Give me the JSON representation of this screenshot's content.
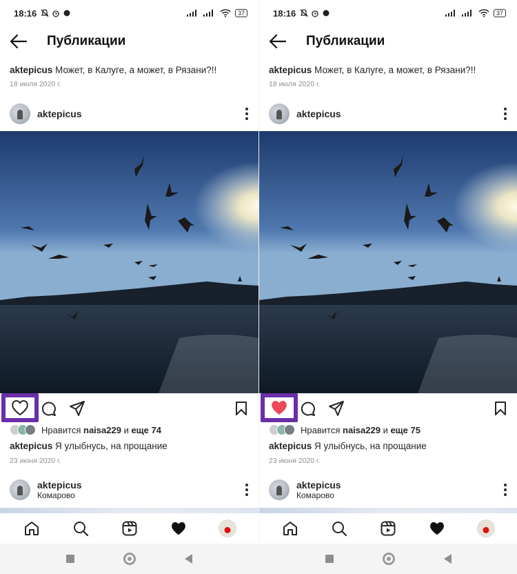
{
  "status_bar": {
    "time": "18:16",
    "battery": "37"
  },
  "top_bar": {
    "title": "Публикации"
  },
  "previous_post": {
    "username": "aktepicus",
    "caption_text": "Может, в Калуге, а может, в Рязани?!!",
    "date": "18 июля 2020 г."
  },
  "post": {
    "username": "aktepicus",
    "likes_prefix": "Нравится",
    "likes_user": "naisa229",
    "likes_and": "и",
    "caption_username": "aktepicus",
    "caption_text": "Я улыбнусь, на прощание",
    "date": "23 июня 2020 г."
  },
  "panels": [
    {
      "state": "not-liked",
      "likes_more": "еще 74",
      "heart_color": "#262626"
    },
    {
      "state": "liked",
      "likes_more": "еще 75",
      "heart_color": "#ed4956"
    }
  ],
  "next_post": {
    "username": "aktepicus",
    "location": "Комарово"
  },
  "highlight_color": "#6a2ea8",
  "icons": {
    "top": [
      "back-arrow-icon"
    ],
    "actions": [
      "heart-icon",
      "comment-icon",
      "share-icon",
      "bookmark-icon"
    ],
    "tabs": [
      "home-icon",
      "search-icon",
      "reels-icon",
      "activity-heart-icon",
      "profile-avatar"
    ],
    "system_nav": [
      "recent-apps-icon",
      "home-circle-icon",
      "back-triangle-icon"
    ]
  }
}
